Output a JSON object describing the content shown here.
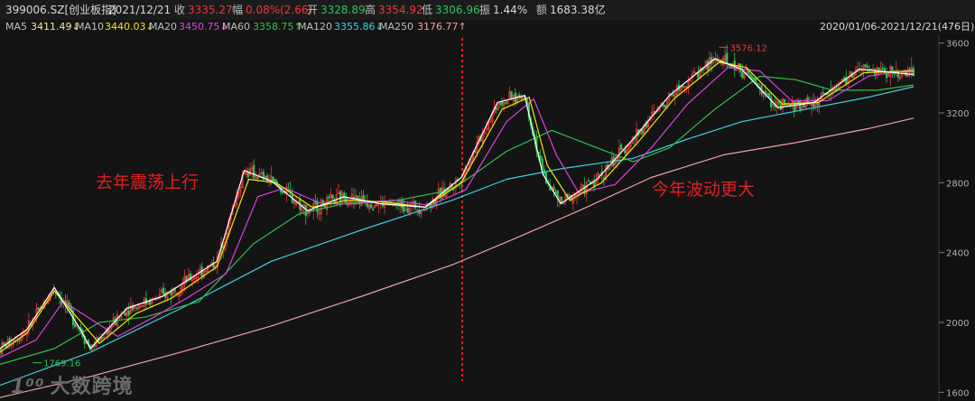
{
  "header": {
    "code": "399006.SZ[创业板指]",
    "date": "2021/12/21",
    "close_label": "收",
    "close": "3335.27",
    "change_label": "幅",
    "change": "0.08%(2.66)",
    "open_label": "开",
    "open": "3328.89",
    "high_label": "高",
    "high": "3354.92",
    "low_label": "低",
    "low": "3306.96",
    "amplitude_label": "振",
    "amplitude": "1.44%",
    "amount_label": "额",
    "amount": "1683.38亿"
  },
  "ma_legend": [
    {
      "label": "MA5",
      "value": "3411.49↓",
      "color": "#ffffff"
    },
    {
      "label": "MA10",
      "value": "3440.03↓",
      "color": "#f2e600"
    },
    {
      "label": "MA20",
      "value": "3450.75↓",
      "color": "#e040e0"
    },
    {
      "label": "MA60",
      "value": "3358.75↑",
      "color": "#2fc04a"
    },
    {
      "label": "MA120",
      "value": "3355.86↓",
      "color": "#3fd0e0"
    },
    {
      "label": "MA250",
      "value": "3176.77↑",
      "color": "#f0a0a0"
    }
  ],
  "range_label": "2020/01/06-2021/12/21(476日)",
  "colors": {
    "up": "#e8383c",
    "down": "#2ec15b",
    "divider": "#e02020",
    "annotation": "#e02020"
  },
  "chart_data": {
    "type": "line",
    "ylim": [
      1550,
      3650
    ],
    "yticks": [
      1600,
      2000,
      2400,
      2800,
      3200,
      3600
    ],
    "n_days": 476,
    "annotations": [
      {
        "text": "去年震荡上行"
      },
      {
        "text": "今年波动更大"
      }
    ],
    "low_marker": "1769.16",
    "high_marker": "3576.12",
    "series": [
      {
        "name": "MA5",
        "color": "#ffffff",
        "points": [
          [
            0,
            1850
          ],
          [
            30,
            1960
          ],
          [
            60,
            2200
          ],
          [
            90,
            1950
          ],
          [
            100,
            1850
          ],
          [
            140,
            2080
          ],
          [
            180,
            2150
          ],
          [
            240,
            2350
          ],
          [
            270,
            2870
          ],
          [
            300,
            2810
          ],
          [
            340,
            2640
          ],
          [
            380,
            2720
          ],
          [
            420,
            2680
          ],
          [
            470,
            2660
          ],
          [
            510,
            2830
          ],
          [
            550,
            3260
          ],
          [
            580,
            3300
          ],
          [
            600,
            2850
          ],
          [
            620,
            2680
          ],
          [
            660,
            2820
          ],
          [
            700,
            3050
          ],
          [
            740,
            3300
          ],
          [
            790,
            3510
          ],
          [
            820,
            3450
          ],
          [
            860,
            3230
          ],
          [
            900,
            3260
          ],
          [
            950,
            3450
          ],
          [
            1010,
            3420
          ]
        ]
      },
      {
        "name": "MA10",
        "color": "#f2e600",
        "points": [
          [
            0,
            1830
          ],
          [
            30,
            1940
          ],
          [
            60,
            2180
          ],
          [
            90,
            2000
          ],
          [
            110,
            1880
          ],
          [
            150,
            2050
          ],
          [
            190,
            2140
          ],
          [
            240,
            2320
          ],
          [
            275,
            2820
          ],
          [
            305,
            2800
          ],
          [
            345,
            2660
          ],
          [
            385,
            2700
          ],
          [
            425,
            2690
          ],
          [
            470,
            2660
          ],
          [
            510,
            2800
          ],
          [
            555,
            3220
          ],
          [
            585,
            3290
          ],
          [
            605,
            2900
          ],
          [
            630,
            2700
          ],
          [
            665,
            2800
          ],
          [
            705,
            3030
          ],
          [
            745,
            3280
          ],
          [
            795,
            3490
          ],
          [
            825,
            3460
          ],
          [
            865,
            3250
          ],
          [
            905,
            3260
          ],
          [
            955,
            3430
          ],
          [
            1010,
            3440
          ]
        ]
      },
      {
        "name": "MA20",
        "color": "#e040e0",
        "points": [
          [
            0,
            1800
          ],
          [
            40,
            1900
          ],
          [
            70,
            2120
          ],
          [
            100,
            2020
          ],
          [
            130,
            1920
          ],
          [
            170,
            2030
          ],
          [
            210,
            2150
          ],
          [
            250,
            2280
          ],
          [
            285,
            2720
          ],
          [
            315,
            2770
          ],
          [
            355,
            2680
          ],
          [
            395,
            2680
          ],
          [
            435,
            2700
          ],
          [
            475,
            2670
          ],
          [
            515,
            2760
          ],
          [
            560,
            3150
          ],
          [
            590,
            3280
          ],
          [
            615,
            2960
          ],
          [
            640,
            2740
          ],
          [
            680,
            2790
          ],
          [
            720,
            3000
          ],
          [
            760,
            3250
          ],
          [
            805,
            3460
          ],
          [
            840,
            3440
          ],
          [
            875,
            3270
          ],
          [
            915,
            3270
          ],
          [
            960,
            3410
          ],
          [
            1010,
            3450
          ]
        ]
      },
      {
        "name": "MA60",
        "color": "#2fc04a",
        "points": [
          [
            0,
            1760
          ],
          [
            60,
            1850
          ],
          [
            110,
            2000
          ],
          [
            160,
            2030
          ],
          [
            220,
            2120
          ],
          [
            280,
            2450
          ],
          [
            330,
            2620
          ],
          [
            380,
            2680
          ],
          [
            440,
            2700
          ],
          [
            500,
            2760
          ],
          [
            560,
            2980
          ],
          [
            610,
            3100
          ],
          [
            660,
            3000
          ],
          [
            700,
            2920
          ],
          [
            740,
            3000
          ],
          [
            790,
            3220
          ],
          [
            840,
            3410
          ],
          [
            880,
            3390
          ],
          [
            920,
            3330
          ],
          [
            970,
            3330
          ],
          [
            1010,
            3360
          ]
        ]
      },
      {
        "name": "MA120",
        "color": "#3fd0e0",
        "points": [
          [
            0,
            1640
          ],
          [
            100,
            1830
          ],
          [
            200,
            2080
          ],
          [
            300,
            2350
          ],
          [
            400,
            2530
          ],
          [
            500,
            2700
          ],
          [
            560,
            2820
          ],
          [
            620,
            2880
          ],
          [
            700,
            2940
          ],
          [
            760,
            3050
          ],
          [
            820,
            3150
          ],
          [
            900,
            3230
          ],
          [
            960,
            3290
          ],
          [
            1010,
            3350
          ]
        ]
      },
      {
        "name": "MA250",
        "color": "#f0a0a0",
        "points": [
          [
            0,
            1570
          ],
          [
            100,
            1690
          ],
          [
            200,
            1830
          ],
          [
            300,
            1980
          ],
          [
            400,
            2150
          ],
          [
            500,
            2330
          ],
          [
            560,
            2460
          ],
          [
            640,
            2640
          ],
          [
            720,
            2830
          ],
          [
            800,
            2960
          ],
          [
            880,
            3030
          ],
          [
            960,
            3110
          ],
          [
            1010,
            3170
          ]
        ]
      }
    ]
  },
  "watermark": "大数跨境"
}
